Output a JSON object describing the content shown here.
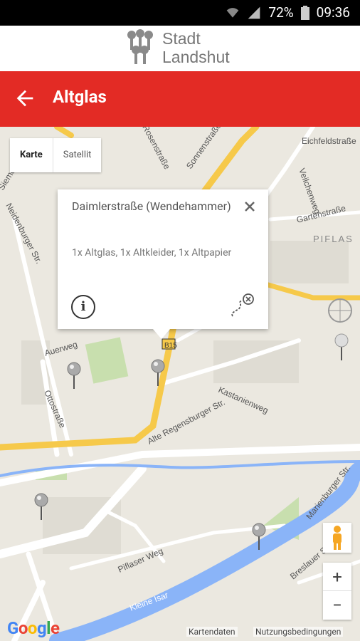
{
  "status_bar": {
    "battery": "72%",
    "time": "09:36",
    "icons": [
      "wifi-icon",
      "signal-icon",
      "battery-icon"
    ]
  },
  "logo": {
    "line1": "Stadt",
    "line2": "Landshut"
  },
  "app_bar": {
    "title": "Altglas",
    "back_icon": "arrow-left-icon",
    "color": "#e32b25"
  },
  "map_type": {
    "options": [
      "Karte",
      "Satellit"
    ],
    "selected": "Karte"
  },
  "popup": {
    "title": "Daimlerstraße (Wendehammer)",
    "description": "1x Altglas, 1x Altkleider, 1x Altpapier",
    "close_icon": "close-icon",
    "info_icon": "info-icon",
    "route_icon": "route-icon"
  },
  "streets": [
    "Eichfeldstraße",
    "Veilchenweg",
    "Gartenstraße",
    "PIFLAS",
    "Sonnenstraße",
    "Rosenstraße",
    "Siemens",
    "Neidenburger Str.",
    "Auerweg",
    "Ottostraße",
    "Alte Regensburger Str.",
    "Kastanienweg",
    "Piflaser Weg",
    "Kleine Isar",
    "Marienburger Str.",
    "Breslauer Str.",
    "B15"
  ],
  "controls": {
    "zoom_in": "+",
    "zoom_out": "−",
    "pegman_icon": "pegman-icon"
  },
  "footer": {
    "google": "Google",
    "map_data": "Kartendaten",
    "terms": "Nutzungsbedingungen"
  }
}
